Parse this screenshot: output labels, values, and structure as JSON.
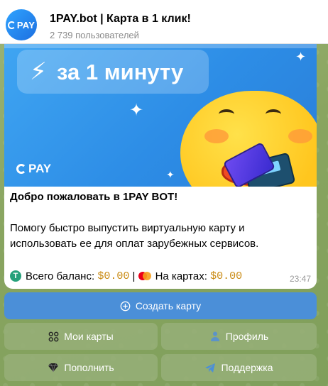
{
  "chat": {
    "title": "1PAY.bot | Карта в 1 клик!",
    "subscribers": "2 739 пользователей",
    "avatar_text": "PAY"
  },
  "banner": {
    "headline": "за 1 минуту",
    "logo_text": "PAY"
  },
  "message": {
    "title": "Добро пожаловать в 1PAY BOT!",
    "body": "Помогу быстро выпустить виртуальную карту и использовать ее для оплат зарубежных сервисов.",
    "balance_label": "Всего баланс:",
    "balance_value": "$0.00",
    "separator": "|",
    "cards_label": "На картах:",
    "cards_value": "$0.00",
    "time": "23:47"
  },
  "keyboard": {
    "create_card": "Создать карту",
    "my_cards": "Мои карты",
    "profile": "Профиль",
    "top_up": "Пополнить",
    "support": "Поддержка"
  },
  "colors": {
    "accent_button": "#4b8fd8",
    "tether": "#26a17b",
    "mono_value": "#c98a12"
  },
  "icons": {
    "create": "plus-circle-icon",
    "my_cards": "grid-icon",
    "profile": "person-icon",
    "top_up": "diamond-icon",
    "support": "send-icon"
  }
}
